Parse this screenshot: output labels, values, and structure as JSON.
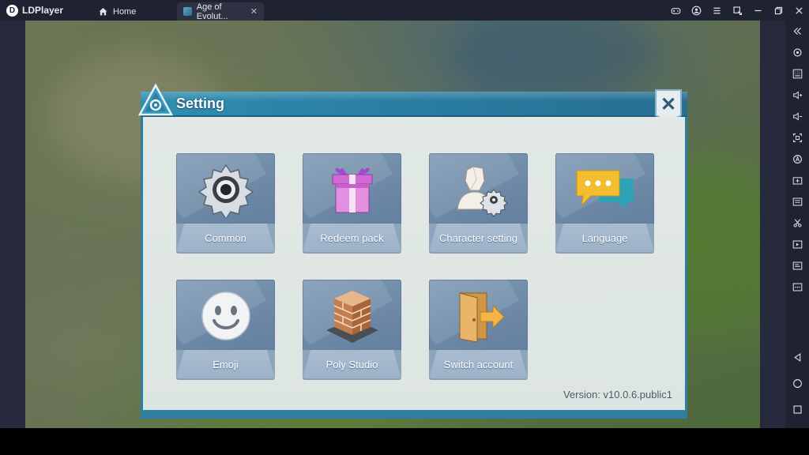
{
  "titlebar": {
    "app_name": "LDPlayer",
    "tabs": [
      {
        "label": "Home",
        "icon": "home-icon"
      },
      {
        "label": "Age of Evolut...",
        "icon": "game-favicon",
        "close": "✕"
      }
    ],
    "icons": [
      "gamepad-icon",
      "account-icon",
      "menu-icon",
      "resize-icon",
      "minimize-icon",
      "restore-icon",
      "close-icon"
    ]
  },
  "sidebar": {
    "icons": [
      "collapse-icon",
      "settings-icon",
      "keyboard-icon",
      "volume-up-icon",
      "volume-down-icon",
      "fullscreen-icon",
      "macro-icon",
      "add-apk-icon",
      "fps-icon",
      "scissors-icon",
      "record-icon",
      "sync-icon",
      "more-icon",
      "back-icon",
      "home-circle-icon",
      "recent-apps-icon"
    ]
  },
  "panel": {
    "title": "Setting",
    "close": "✕",
    "version": "Version: v10.0.6.public1",
    "tiles": [
      {
        "label": "Common",
        "icon": "gear-icon"
      },
      {
        "label": "Redeem pack",
        "icon": "gift-box-icon"
      },
      {
        "label": "Character setting",
        "icon": "character-gear-icon"
      },
      {
        "label": "Language",
        "icon": "chat-bubbles-icon"
      },
      {
        "label": "Emoji",
        "icon": "smiley-icon"
      },
      {
        "label": "Poly Studio",
        "icon": "brick-cube-icon"
      },
      {
        "label": "Switch account",
        "icon": "door-arrow-icon"
      }
    ]
  },
  "colors": {
    "header_blue": "#2b7fa5",
    "tile_blue": "#6a86a4",
    "panel_bg": "#e1e8e6",
    "chrome_dark": "#1f2230"
  }
}
